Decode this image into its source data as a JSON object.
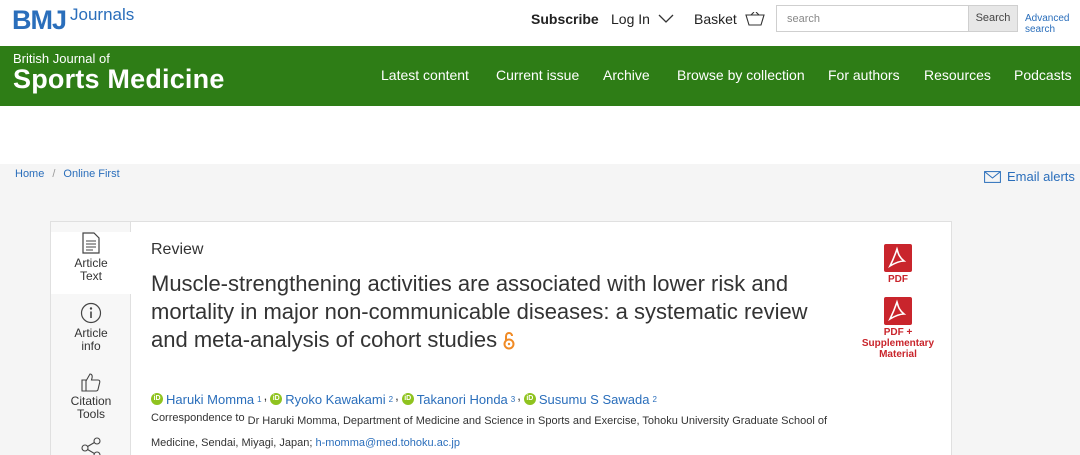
{
  "header": {
    "logo_mark": "BMJ",
    "logo_suffix": "Journals",
    "subscribe": "Subscribe",
    "login": "Log In",
    "basket": "Basket",
    "search_placeholder": "search",
    "search_button": "Search",
    "advanced_search": "Advanced search"
  },
  "journal": {
    "name_small": "British Journal of",
    "name_big": "Sports Medicine"
  },
  "nav": {
    "items": [
      "Latest content",
      "Current issue",
      "Archive",
      "Browse by collection",
      "For authors",
      "Resources",
      "Podcasts"
    ]
  },
  "breadcrumb": {
    "home": "Home",
    "separator": "/",
    "current": "Online First"
  },
  "email_alerts": "Email alerts",
  "side_tabs": [
    {
      "label1": "Article",
      "label2": "Text",
      "icon": "document-icon"
    },
    {
      "label1": "Article",
      "label2": "info",
      "icon": "info-icon"
    },
    {
      "label1": "Citation",
      "label2": "Tools",
      "icon": "thumbs-up-icon"
    },
    {
      "label1": "",
      "label2": "",
      "icon": "share-icon"
    }
  ],
  "article": {
    "type": "Review",
    "title_line1": "Muscle-strengthening activities are associated with lower risk and",
    "title_line2": "mortality in major non-communicable diseases: a systematic review",
    "title_line3": "and meta-analysis of cohort studies",
    "pdf_label": "PDF",
    "pdf_supp_line1": "PDF +",
    "pdf_supp_line2": "Supplementary",
    "pdf_supp_line3": "Material",
    "authors": [
      {
        "name": "Haruki Momma",
        "aff": "1"
      },
      {
        "name": "Ryoko Kawakami",
        "aff": "2"
      },
      {
        "name": "Takanori Honda",
        "aff": "3"
      },
      {
        "name": "Susumu S Sawada",
        "aff": "2"
      }
    ],
    "corr_label": "Correspondence to",
    "corr_text": "Dr Haruki Momma, Department of Medicine and Science in Sports and Exercise, Tohoku University Graduate School of",
    "corr_text2": "Medicine, Sendai, Miyagi, Japan;",
    "corr_email": "h-momma@med.tohoku.ac.jp"
  },
  "colors": {
    "brand_blue": "#2a6ebb",
    "nav_green": "#2e7d16",
    "pdf_red": "#c9252c",
    "orcid_green": "#8fc31f",
    "open_access_orange": "#f08a24"
  }
}
